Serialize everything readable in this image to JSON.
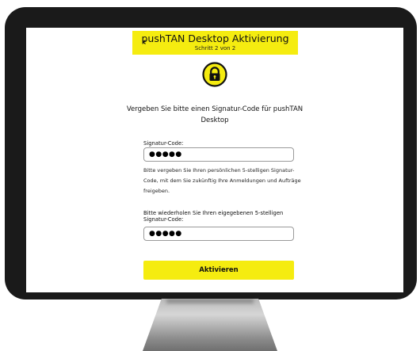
{
  "header": {
    "back_label": "‹",
    "title": "pushTAN Desktop Aktivierung",
    "subtitle": "Schritt 2 von 2"
  },
  "lock_icon": "lock-icon",
  "intro_text": "Vergeben Sie bitte einen Signatur-Code für pushTAN Desktop",
  "signatur": {
    "label": "Signatur-Code:",
    "value": "●●●●●",
    "hint": "Bitte vergeben Sie Ihren persönlichen 5-stelligen Signatur-Code, mit dem Sie zukünftig Ihre Anmeldungen und Aufträge freigeben."
  },
  "confirm": {
    "label": "Bitte wiederholen Sie Ihren eigegebenen 5-stelligen Signatur-Code:",
    "value": "●●●●●"
  },
  "activate_label": "Aktivieren",
  "colors": {
    "accent_yellow": "#f5ec10",
    "bezel": "#1a1a1a"
  }
}
